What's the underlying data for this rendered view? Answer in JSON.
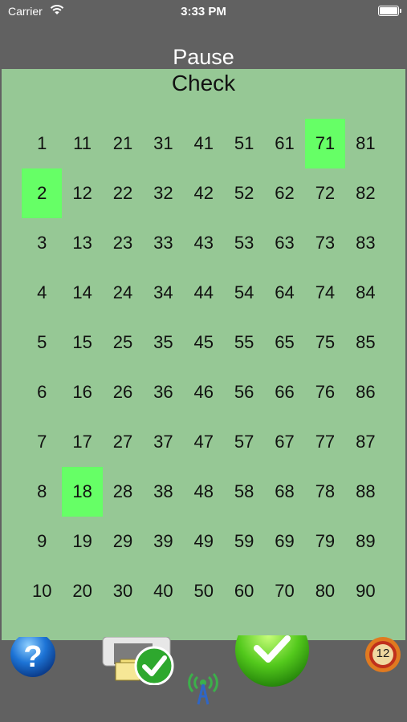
{
  "status_bar": {
    "carrier": "Carrier",
    "time": "3:33 PM"
  },
  "header": {
    "pause_label": "Pause"
  },
  "panel": {
    "title": "Check",
    "numbers": [
      [
        1,
        11,
        21,
        31,
        41,
        51,
        61,
        71,
        81
      ],
      [
        2,
        12,
        22,
        32,
        42,
        52,
        62,
        72,
        82
      ],
      [
        3,
        13,
        23,
        33,
        43,
        53,
        63,
        73,
        83
      ],
      [
        4,
        14,
        24,
        34,
        44,
        54,
        64,
        74,
        84
      ],
      [
        5,
        15,
        25,
        35,
        45,
        55,
        65,
        75,
        85
      ],
      [
        6,
        16,
        26,
        36,
        46,
        56,
        66,
        76,
        86
      ],
      [
        7,
        17,
        27,
        37,
        47,
        57,
        67,
        77,
        87
      ],
      [
        8,
        18,
        28,
        38,
        48,
        58,
        68,
        78,
        88
      ],
      [
        9,
        19,
        29,
        39,
        49,
        59,
        69,
        79,
        89
      ],
      [
        10,
        20,
        30,
        40,
        50,
        60,
        70,
        80,
        90
      ]
    ],
    "highlighted": [
      71,
      2,
      18
    ],
    "highlight_color": "#66ff66",
    "background_color": "#96c895"
  },
  "toolbar": {
    "help_icon": "question-mark-icon",
    "save_icon": "save-check-icon",
    "signal_icon": "signal-antenna-icon",
    "confirm_icon": "green-check-icon",
    "timer_label": "12"
  }
}
